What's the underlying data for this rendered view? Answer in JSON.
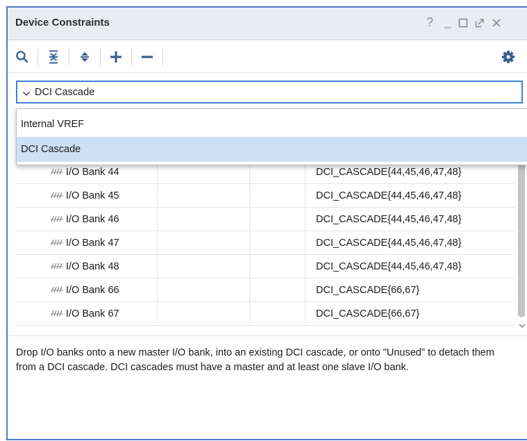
{
  "panel": {
    "title": "Device Constraints",
    "window_controls": {
      "help": "?",
      "minimize": "_",
      "maximize": "□",
      "float": "⇗",
      "close": "×"
    }
  },
  "toolbar": {
    "icons": [
      "search-icon",
      "collapse-all-icon",
      "expand-all-icon",
      "add-icon",
      "remove-icon",
      "gear-icon"
    ]
  },
  "dropdown": {
    "selected": "DCI Cascade",
    "options": [
      "Internal VREF",
      "DCI Cascade"
    ],
    "highlighted": "DCI Cascade"
  },
  "table": {
    "rows": [
      {
        "name": "I/O Bank 44",
        "col2": "",
        "col3": "",
        "cascade": "DCI_CASCADE{44,45,46,47,48}"
      },
      {
        "name": "I/O Bank 45",
        "col2": "",
        "col3": "",
        "cascade": "DCI_CASCADE{44,45,46,47,48}"
      },
      {
        "name": "I/O Bank 46",
        "col2": "",
        "col3": "",
        "cascade": "DCI_CASCADE{44,45,46,47,48}"
      },
      {
        "name": "I/O Bank 47",
        "col2": "",
        "col3": "",
        "cascade": "DCI_CASCADE{44,45,46,47,48}"
      },
      {
        "name": "I/O Bank 48",
        "col2": "",
        "col3": "",
        "cascade": "DCI_CASCADE{44,45,46,47,48}"
      },
      {
        "name": "I/O Bank 66",
        "col2": "",
        "col3": "",
        "cascade": "DCI_CASCADE{66,67}"
      },
      {
        "name": "I/O Bank 67",
        "col2": "",
        "col3": "",
        "cascade": "DCI_CASCADE{66,67}"
      }
    ]
  },
  "help_text": "Drop I/O banks onto a new master I/O bank, into an existing DCI cascade, or onto \"Unused\" to detach them from a DCI cascade. DCI cascades must have a master and at least one slave I/O bank.",
  "colors": {
    "frame_border": "#4d79c9",
    "title_bar": "#e9ecf1",
    "selection": "#cde0f5",
    "focus_border": "#3f7fd6",
    "icon_blue": "#3a5f8f"
  }
}
